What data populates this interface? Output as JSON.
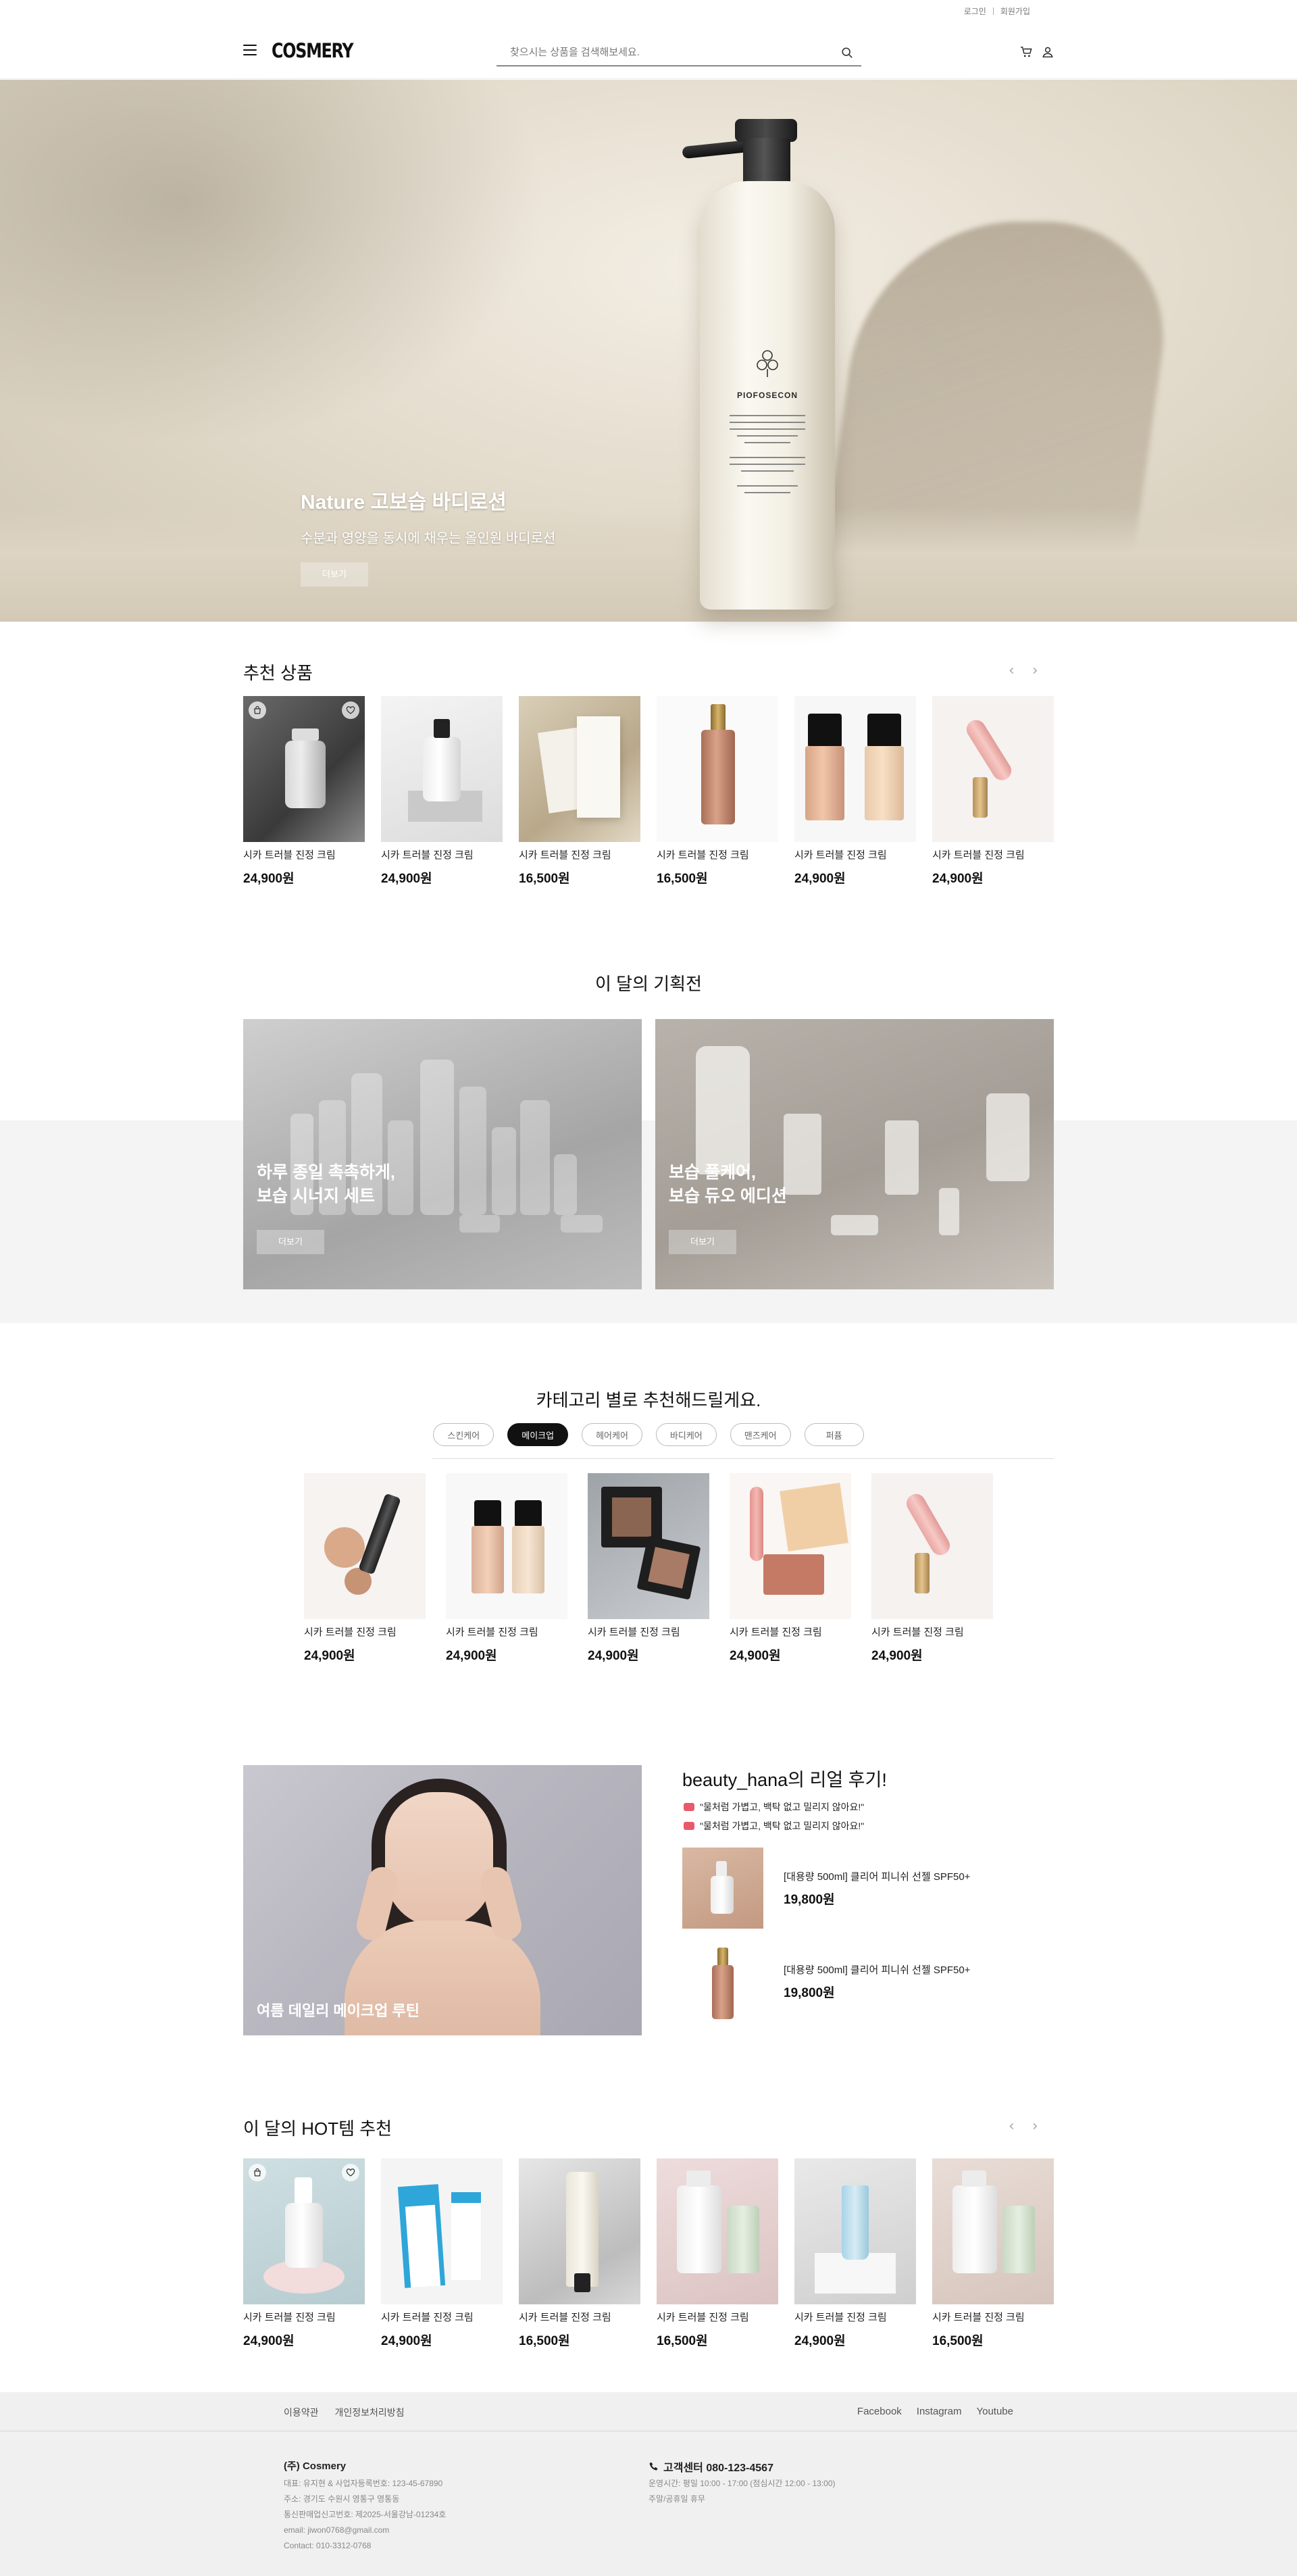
{
  "util": {
    "login": "로그인",
    "signup": "회원가입"
  },
  "header": {
    "logo": "COSMERY",
    "search_placeholder": "찾으시는 상품을 검색해보세요."
  },
  "hero": {
    "title": "Nature 고보습 바디로션",
    "subtitle": "수분과 영양을 동시에 채우는 올인원 바디로션",
    "button": "더보기",
    "bottle_brand": "PIOFOSECON"
  },
  "recommended": {
    "title": "추천 상품",
    "products": [
      {
        "name": "시카 트러블 진정 크림",
        "price": "24,900원"
      },
      {
        "name": "시카 트러블 진정 크림",
        "price": "24,900원"
      },
      {
        "name": "시카 트러블 진정 크림",
        "price": "16,500원"
      },
      {
        "name": "시카 트러블 진정 크림",
        "price": "16,500원"
      },
      {
        "name": "시카 트러블 진정 크림",
        "price": "24,900원"
      },
      {
        "name": "시카 트러블 진정 크림",
        "price": "24,900원"
      }
    ]
  },
  "monthly": {
    "title": "이 달의 기획전",
    "promos": [
      {
        "line1": "하루 종일 촉촉하게,",
        "line2": "보습 시너지 세트",
        "button": "더보기"
      },
      {
        "line1": "보습 풀케어,",
        "line2": "보습 듀오 에디션",
        "button": "더보기"
      }
    ]
  },
  "category": {
    "title": "카테고리 별로 추천해드릴게요.",
    "tabs": [
      "스킨케어",
      "메이크업",
      "헤어케어",
      "바디케어",
      "맨즈케어",
      "퍼퓸"
    ],
    "active_tab": "메이크업",
    "products": [
      {
        "name": "시카 트러블 진정 크림",
        "price": "24,900원"
      },
      {
        "name": "시카 트러블 진정 크림",
        "price": "24,900원"
      },
      {
        "name": "시카 트러블 진정 크림",
        "price": "24,900원"
      },
      {
        "name": "시카 트러블 진정 크림",
        "price": "24,900원"
      },
      {
        "name": "시카 트러블 진정 크림",
        "price": "24,900원"
      }
    ]
  },
  "review": {
    "caption": "여름 데일리 메이크업 루틴",
    "title": "beauty_hana의 리얼 후기!",
    "quotes": [
      "\"물처럼 가볍고, 백탁 없고 밀리지 않아요!\"",
      "\"물처럼 가볍고, 백탁 없고 밀리지 않아요!\""
    ],
    "items": [
      {
        "name": "[대용량 500ml] 클리어 피니쉬 선젤 SPF50+",
        "price": "19,800원"
      },
      {
        "name": "[대용량 500ml] 클리어 피니쉬 선젤 SPF50+",
        "price": "19,800원"
      }
    ]
  },
  "hot": {
    "title": "이 달의 HOT템 추천",
    "products": [
      {
        "name": "시카 트러블 진정 크림",
        "price": "24,900원"
      },
      {
        "name": "시카 트러블 진정 크림",
        "price": "24,900원"
      },
      {
        "name": "시카 트러블 진정 크림",
        "price": "16,500원"
      },
      {
        "name": "시카 트러블 진정 크림",
        "price": "16,500원"
      },
      {
        "name": "시카 트러블 진정 크림",
        "price": "24,900원"
      },
      {
        "name": "시카 트러블 진정 크림",
        "price": "16,500원"
      }
    ]
  },
  "footer": {
    "links_left": [
      "이용약관",
      "개인정보처리방침"
    ],
    "links_right": [
      "Facebook",
      "Instagram",
      "Youtube"
    ],
    "company": "(주) Cosmery",
    "info": [
      "대표: 유지현 & 사업자등록번호: 123-45-67890",
      "주소: 경기도 수원시 영통구 영통동",
      "통신판매업신고번호: 제2025-서울강남-01234호",
      "email: jiwon0768@gmail.com",
      "Contact: 010-3312-0768"
    ],
    "cs_label": "고객센터 080-123-4567",
    "hours": [
      "운영시간: 평일 10:00 - 17:00 (점심시간 12:00 - 13:00)",
      "주말/공휴일 휴무"
    ]
  },
  "colors": {
    "accent": "#111111",
    "quote_icon": "#e85a6b",
    "band": "#f4f4f4",
    "footer_bg": "#f0f0f0"
  }
}
